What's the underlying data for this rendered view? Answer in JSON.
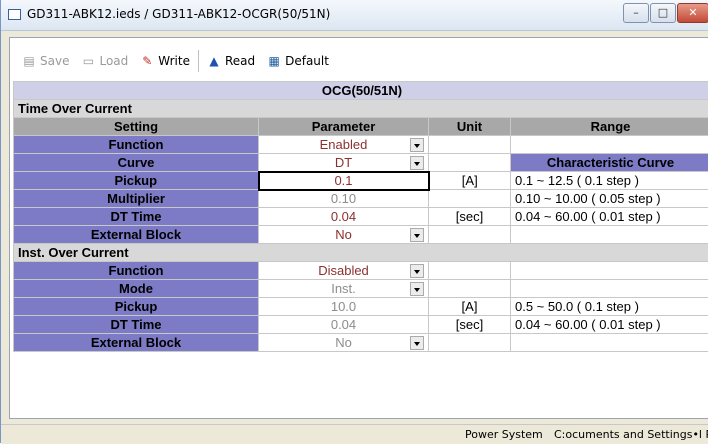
{
  "window": {
    "title": "GD311-ABK12.ieds / GD311-ABK12-OCGR(50/51N)",
    "buttons": {
      "minimize": "–",
      "maximize": "□",
      "close": "✕"
    }
  },
  "toolbar": {
    "save": "Save",
    "load": "Load",
    "write": "Write",
    "read": "Read",
    "default": "Default"
  },
  "grid": {
    "caption": "OCG(50/51N)",
    "headers": {
      "setting": "Setting",
      "parameter": "Parameter",
      "unit": "Unit",
      "range": "Range"
    },
    "time_over_current": {
      "title": "Time Over Current",
      "characteristic_curve": "Characteristic Curve",
      "rows": [
        {
          "setting": "Function",
          "parameter": "Enabled",
          "unit": "",
          "range": ""
        },
        {
          "setting": "Curve",
          "parameter": "DT",
          "unit": "",
          "range": "Characteristic Curve"
        },
        {
          "setting": "Pickup",
          "parameter": "0.1",
          "unit": "[A]",
          "range": "0.1 ~ 12.5 ( 0.1 step )"
        },
        {
          "setting": "Multiplier",
          "parameter": "0.10",
          "unit": "",
          "range": "0.10 ~ 10.00 ( 0.05 step )"
        },
        {
          "setting": "DT Time",
          "parameter": "0.04",
          "unit": "[sec]",
          "range": "0.04 ~ 60.00 ( 0.01 step )"
        },
        {
          "setting": "External Block",
          "parameter": "No",
          "unit": "",
          "range": ""
        }
      ]
    },
    "inst_over_current": {
      "title": "Inst. Over Current",
      "rows": [
        {
          "setting": "Function",
          "parameter": "Disabled",
          "unit": "",
          "range": ""
        },
        {
          "setting": "Mode",
          "parameter": "Inst.",
          "unit": "",
          "range": ""
        },
        {
          "setting": "Pickup",
          "parameter": "10.0",
          "unit": "[A]",
          "range": "0.5 ~ 50.0 ( 0.1 step )"
        },
        {
          "setting": "DT Time",
          "parameter": "0.04",
          "unit": "[sec]",
          "range": "0.04 ~ 60.00 ( 0.01 step )"
        },
        {
          "setting": "External Block",
          "parameter": "No",
          "unit": "",
          "range": ""
        }
      ]
    }
  },
  "status": {
    "left": "Power System",
    "right": "C:ocuments and Settings•l Po"
  }
}
